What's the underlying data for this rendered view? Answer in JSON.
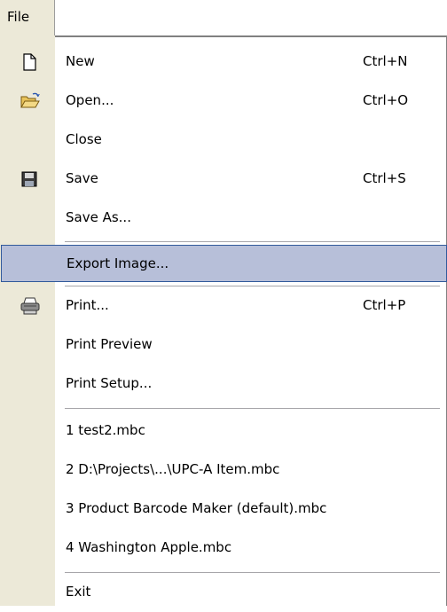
{
  "menubar": {
    "file_label": "File"
  },
  "menu": {
    "new": {
      "label": "New",
      "shortcut": "Ctrl+N"
    },
    "open": {
      "label": "Open...",
      "shortcut": "Ctrl+O"
    },
    "close": {
      "label": "Close"
    },
    "save": {
      "label": "Save",
      "shortcut": "Ctrl+S"
    },
    "save_as": {
      "label": "Save As..."
    },
    "export": {
      "label": "Export Image..."
    },
    "print": {
      "label": "Print...",
      "shortcut": "Ctrl+P"
    },
    "print_preview": {
      "label": "Print Preview"
    },
    "print_setup": {
      "label": "Print Setup..."
    },
    "recent": [
      {
        "label": "1 test2.mbc"
      },
      {
        "label": "2 D:\\Projects\\...\\UPC-A Item.mbc"
      },
      {
        "label": "3 Product Barcode Maker (default).mbc"
      },
      {
        "label": "4 Washington Apple.mbc"
      }
    ],
    "exit": {
      "label": "Exit"
    }
  },
  "icons": {
    "new": "new-document-icon",
    "open": "open-folder-icon",
    "save": "floppy-disk-icon",
    "print": "printer-icon"
  },
  "colors": {
    "selection_fill": "#b7bfd9",
    "selection_border": "#31599b",
    "gutter": "#ece9d8"
  }
}
